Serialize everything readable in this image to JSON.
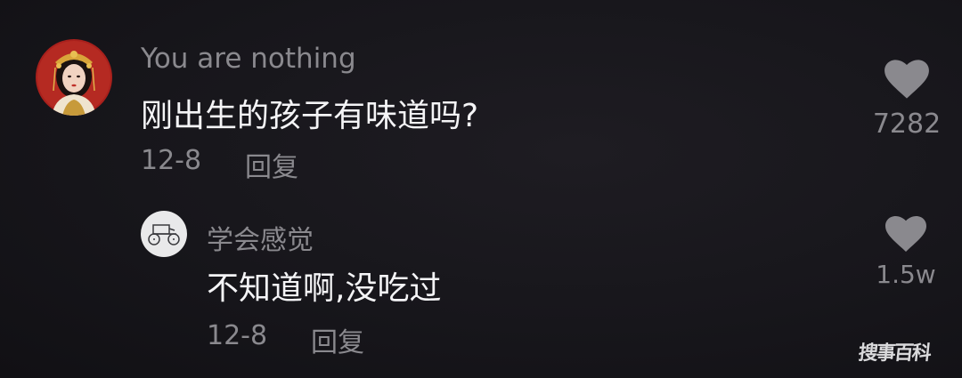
{
  "comments": [
    {
      "username": "You are nothing",
      "text": "刚出生的孩子有味道吗?",
      "date": "12-8",
      "reply_label": "回复",
      "like_count": "7282",
      "avatar": "avatar-woman-traditional-headdress",
      "like_icon": "heart-icon"
    },
    {
      "username": "学会感觉",
      "text": "不知道啊,没吃过",
      "date": "12-8",
      "reply_label": "回复",
      "like_count": "1.5w",
      "avatar": "avatar-vintage-car-sketch",
      "like_icon": "heart-icon"
    }
  ],
  "watermark": "搜事百科",
  "colors": {
    "background": "#17161b",
    "primary_text": "#f4f4f6",
    "secondary_text": "#8a898e",
    "icon": "#8a898e"
  }
}
